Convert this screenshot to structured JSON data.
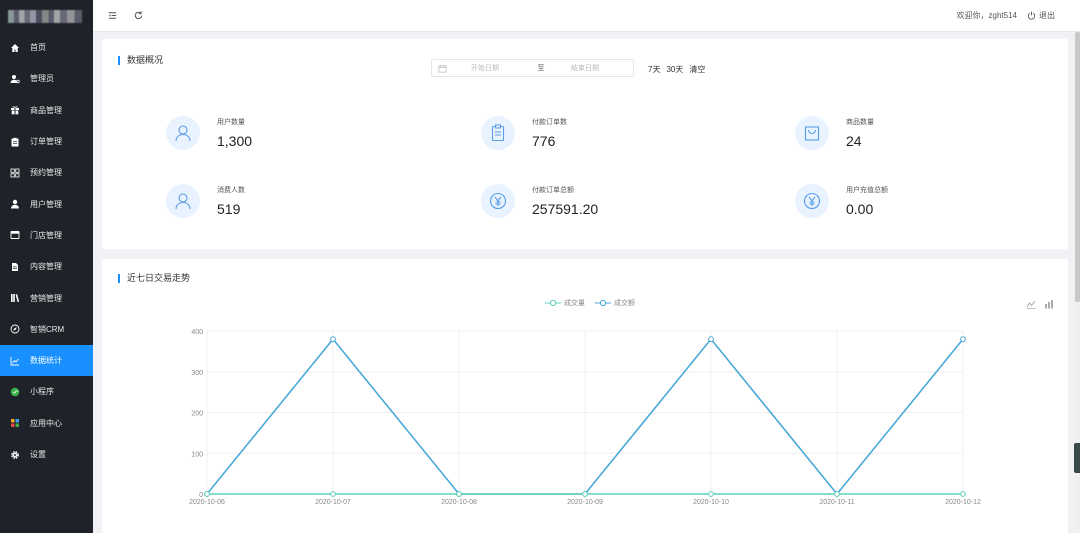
{
  "sidebar": {
    "items": [
      {
        "label": "首页",
        "icon": "home-icon"
      },
      {
        "label": "管理员",
        "icon": "admin-icon"
      },
      {
        "label": "商品管理",
        "icon": "gift-icon"
      },
      {
        "label": "订单管理",
        "icon": "clipboard-icon"
      },
      {
        "label": "预约管理",
        "icon": "grid-icon"
      },
      {
        "label": "用户管理",
        "icon": "user-icon"
      },
      {
        "label": "门店管理",
        "icon": "store-icon"
      },
      {
        "label": "内容管理",
        "icon": "document-icon"
      },
      {
        "label": "营销管理",
        "icon": "books-icon"
      },
      {
        "label": "智销CRM",
        "icon": "compass-icon"
      },
      {
        "label": "数据统计",
        "icon": "chart-icon",
        "active": true
      },
      {
        "label": "小程序",
        "icon": "mini-program-icon"
      },
      {
        "label": "应用中心",
        "icon": "apps-icon"
      },
      {
        "label": "设置",
        "icon": "gear-icon"
      }
    ]
  },
  "topbar": {
    "welcome": "欢迎你，zght514",
    "logout": "退出"
  },
  "overview": {
    "title": "数据概况",
    "date_start_placeholder": "开始日期",
    "date_sep": "至",
    "date_end_placeholder": "结束日期",
    "quick": [
      "7天",
      "30天",
      "清空"
    ],
    "stats": [
      {
        "label": "用户数量",
        "value": "1,300",
        "icon": "user-outline-icon"
      },
      {
        "label": "付款订单数",
        "value": "776",
        "icon": "clipboard-outline-icon"
      },
      {
        "label": "商品数量",
        "value": "24",
        "icon": "bag-outline-icon"
      },
      {
        "label": "消费人数",
        "value": "519",
        "icon": "user-outline-icon"
      },
      {
        "label": "付款订单总额",
        "value": "257591.20",
        "icon": "yuan-circle-icon"
      },
      {
        "label": "用户充值总额",
        "value": "0.00",
        "icon": "yuan-circle-icon"
      }
    ]
  },
  "trend": {
    "title": "近七日交易走势"
  },
  "colors": {
    "accent": "#1890ff",
    "sidebar_bg": "#1f2329",
    "series_volume": "#5fd0b8",
    "series_amount": "#4aa9d8"
  },
  "chart_data": {
    "type": "line",
    "x": [
      "2020-10-06",
      "2020-10-07",
      "2020-10-08",
      "2020-10-09",
      "2020-10-10",
      "2020-10-11",
      "2020-10-12"
    ],
    "series": [
      {
        "name": "成交量",
        "values": [
          0,
          0,
          0,
          0,
          0,
          0,
          0
        ]
      },
      {
        "name": "成交额",
        "values": [
          0,
          380,
          0,
          0,
          380,
          0,
          380
        ]
      }
    ],
    "ylim": [
      0,
      400
    ],
    "yticks": [
      0,
      100,
      200,
      300,
      400
    ],
    "grid": true,
    "legend": "top-center"
  }
}
